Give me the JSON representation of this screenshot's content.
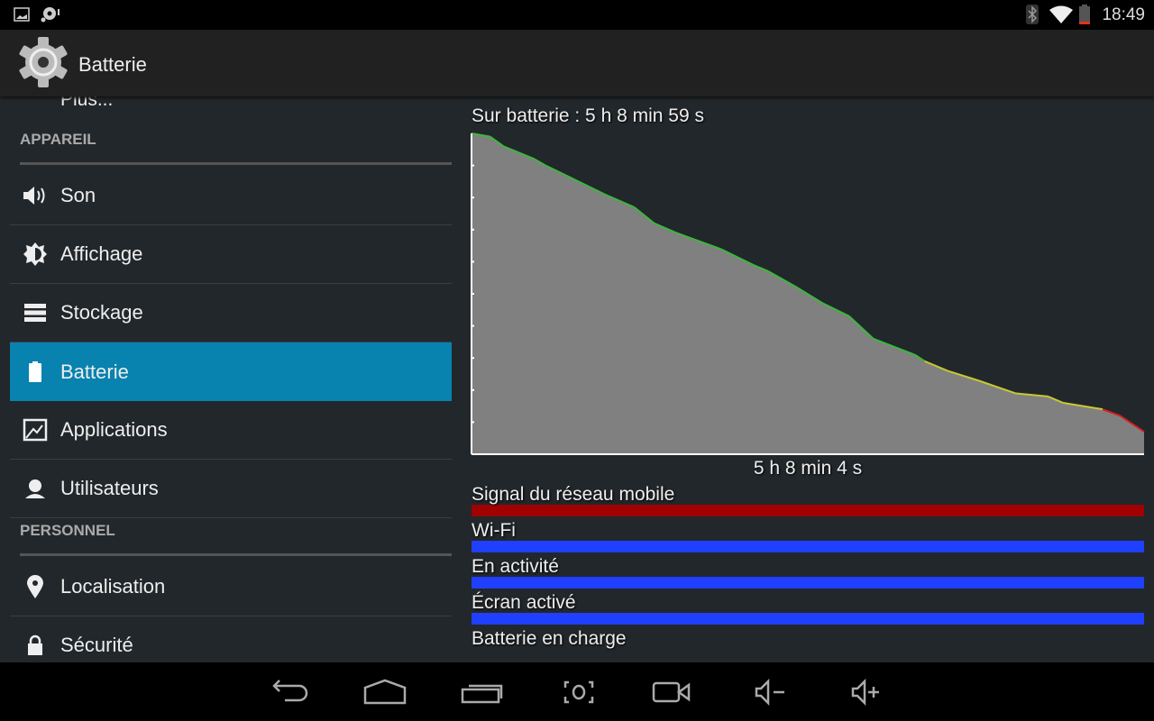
{
  "status_bar": {
    "time": "18:49",
    "icons": [
      "image-icon",
      "sd-card-icon",
      "bluetooth-icon",
      "wifi-icon",
      "battery-low-icon"
    ]
  },
  "action_bar": {
    "title": "Batterie",
    "icon": "settings-gear-icon"
  },
  "sidebar": {
    "partial_item": "Plus...",
    "sections": [
      {
        "header": "APPAREIL",
        "items": [
          {
            "label": "Son",
            "icon": "volume-icon"
          },
          {
            "label": "Affichage",
            "icon": "brightness-icon"
          },
          {
            "label": "Stockage",
            "icon": "storage-icon"
          },
          {
            "label": "Batterie",
            "icon": "battery-icon",
            "selected": true
          },
          {
            "label": "Applications",
            "icon": "apps-icon"
          },
          {
            "label": "Utilisateurs",
            "icon": "user-icon"
          }
        ]
      },
      {
        "header": "PERSONNEL",
        "items": [
          {
            "label": "Localisation",
            "icon": "location-pin-icon"
          },
          {
            "label": "Sécurité",
            "icon": "lock-icon"
          }
        ]
      }
    ],
    "selected_color": "#0882ae"
  },
  "chart_data": {
    "type": "area",
    "title": "Sur batterie : 5 h 8 min 59 s",
    "xlabel": "5 h 8 min 4 s",
    "x_unit": "minutes",
    "y_unit": "percent",
    "xlim": [
      0,
      308
    ],
    "ylim": [
      0,
      100
    ],
    "y_ticks": 10,
    "points": [
      [
        0,
        100
      ],
      [
        8.5,
        99
      ],
      [
        14.6,
        96
      ],
      [
        28.8,
        92
      ],
      [
        33.9,
        90
      ],
      [
        43,
        87
      ],
      [
        49,
        85
      ],
      [
        61,
        81
      ],
      [
        74.5,
        77
      ],
      [
        83.6,
        72
      ],
      [
        93.8,
        69
      ],
      [
        114,
        64
      ],
      [
        129,
        59
      ],
      [
        136,
        57
      ],
      [
        149,
        52
      ],
      [
        161,
        47
      ],
      [
        173,
        43
      ],
      [
        184,
        36
      ],
      [
        203,
        31
      ],
      [
        207.5,
        29
      ],
      [
        218,
        26
      ],
      [
        232,
        23
      ],
      [
        249,
        19
      ],
      [
        264,
        18
      ],
      [
        271,
        16
      ],
      [
        289,
        14
      ],
      [
        297,
        12
      ],
      [
        308,
        7
      ]
    ],
    "color_levels": [
      {
        "min": 29,
        "color": "#3cb83c"
      },
      {
        "min": 14,
        "color": "#c8c832"
      },
      {
        "min": 0,
        "color": "#d62020"
      }
    ],
    "fill_color": "#808080"
  },
  "bars": [
    {
      "label": "Signal du réseau mobile",
      "color": "#a00000",
      "fraction": 1
    },
    {
      "label": "Wi-Fi",
      "color": "#2040ff",
      "fraction": 1
    },
    {
      "label": "En activité",
      "color": "#2040ff",
      "fraction": 1
    },
    {
      "label": "Écran activé",
      "color": "#2040ff",
      "fraction": 1
    },
    {
      "label": "Batterie en charge",
      "color": "#2040ff",
      "fraction": 0
    }
  ],
  "nav_bar": [
    "back-icon",
    "home-icon",
    "recents-icon",
    "screenshot-icon",
    "screen-record-icon",
    "volume-down-icon",
    "volume-up-icon"
  ]
}
